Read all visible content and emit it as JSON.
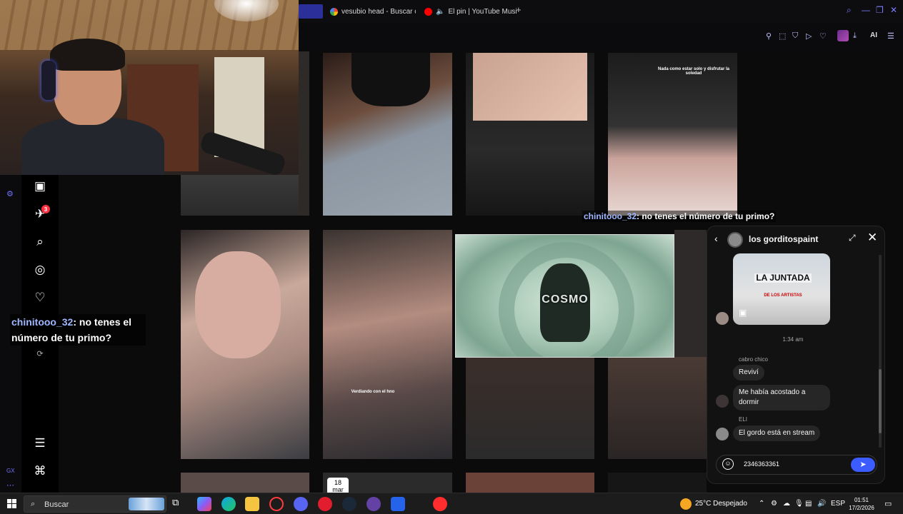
{
  "browser": {
    "tabs": [
      {
        "title": "vesubio head - Buscar co"
      },
      {
        "title": "El pin | YouTube Music"
      }
    ],
    "new_tab": "+",
    "ai_label": "AI"
  },
  "stream_chat": {
    "username": "chinitooo_32",
    "message": ": no tenes el número de tu primo?"
  },
  "posts": {
    "caption_1": "Nada como estar solo y disfrutar la soledad",
    "caption_2": "Verdiando con el hno",
    "date_day": "18",
    "date_month": "mar"
  },
  "video": {
    "logo": "COSMO"
  },
  "dm": {
    "title": "los gorditospaint",
    "shared_reel_title": "LA JUNTADA",
    "shared_reel_sub": "DE LOS ARTISTAS",
    "time": "1:34 am",
    "messages": [
      {
        "sender": "cabro chico",
        "text": "Reviví"
      },
      {
        "sender": "",
        "text": "Me había acostado a dormir"
      },
      {
        "sender": "ELI",
        "text": "El gordo está en stream"
      }
    ],
    "input_value": "2346363361"
  },
  "taskbar": {
    "search_placeholder": "Buscar",
    "weather": "25°C  Despejado",
    "language": "ESP",
    "time": "01:51",
    "date": "17/2/2026"
  },
  "colors": {
    "accent": "#3d5cff",
    "opera": "#6e73ff",
    "notification": "#ff3040"
  }
}
